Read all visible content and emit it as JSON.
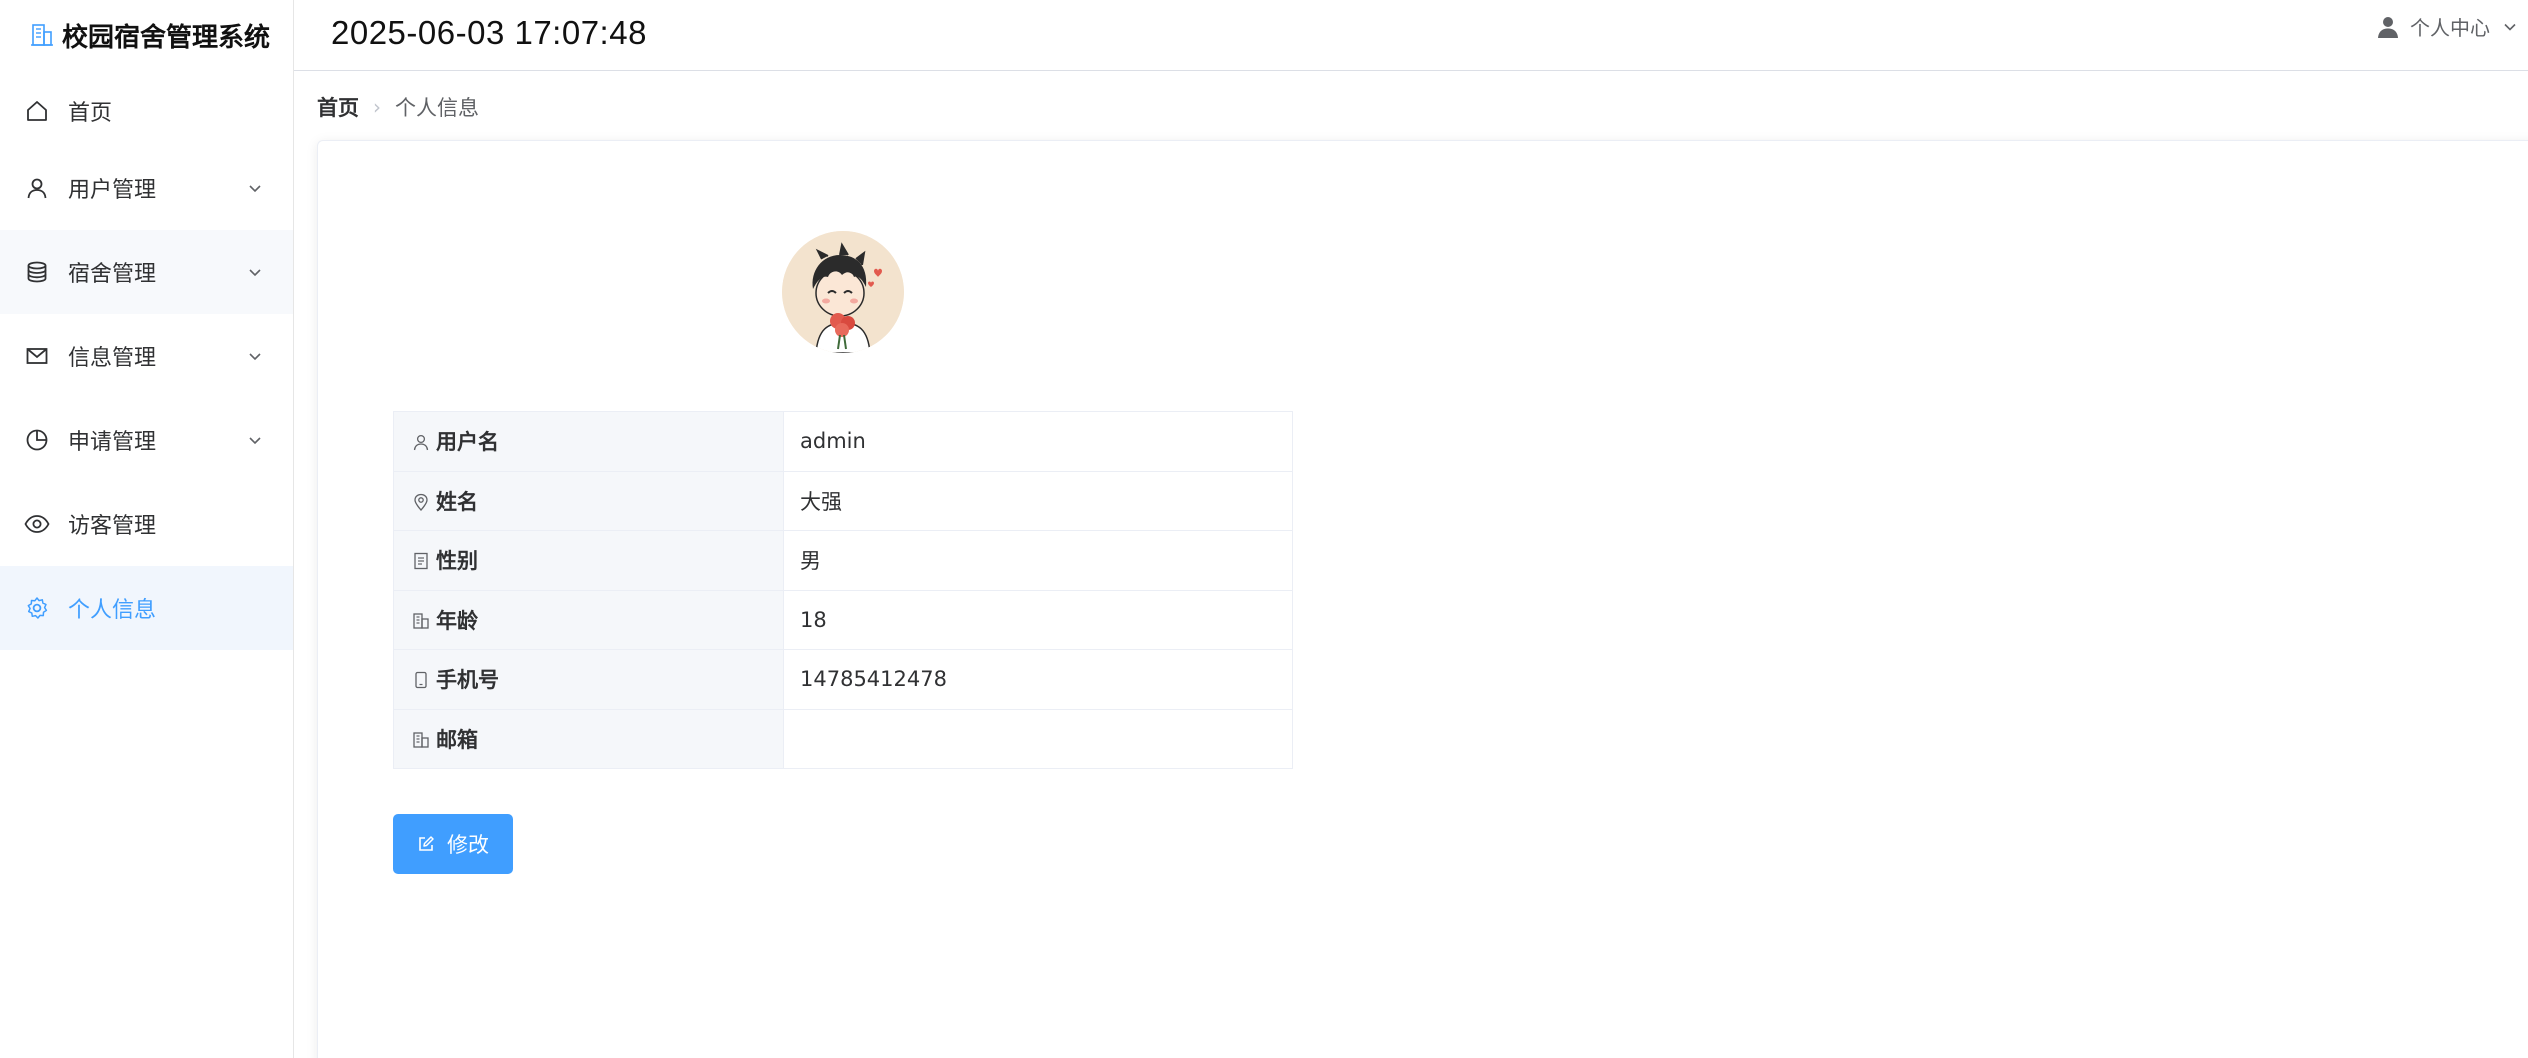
{
  "app": {
    "title": "校园宿舍管理系统",
    "accent_color": "#409eff"
  },
  "sidebar": {
    "items": [
      {
        "label": "首页",
        "icon": "home-icon",
        "has_children": false,
        "active": false
      },
      {
        "label": "用户管理",
        "icon": "user-icon",
        "has_children": true,
        "active": false
      },
      {
        "label": "宿舍管理",
        "icon": "database-icon",
        "has_children": true,
        "active": false
      },
      {
        "label": "信息管理",
        "icon": "mail-icon",
        "has_children": true,
        "active": false
      },
      {
        "label": "申请管理",
        "icon": "pie-chart-icon",
        "has_children": true,
        "active": false
      },
      {
        "label": "访客管理",
        "icon": "eye-icon",
        "has_children": false,
        "active": false
      },
      {
        "label": "个人信息",
        "icon": "gear-icon",
        "has_children": false,
        "active": true
      }
    ]
  },
  "header": {
    "datetime": "2025-06-03 17:07:48",
    "user_menu_label": "个人中心"
  },
  "breadcrumb": {
    "home": "首页",
    "current": "个人信息"
  },
  "profile": {
    "fields": [
      {
        "label": "用户名",
        "icon": "user-icon",
        "value": "admin"
      },
      {
        "label": "姓名",
        "icon": "location-icon",
        "value": "大强"
      },
      {
        "label": "性别",
        "icon": "document-icon",
        "value": "男"
      },
      {
        "label": "年龄",
        "icon": "building-icon",
        "value": "18"
      },
      {
        "label": "手机号",
        "icon": "phone-icon",
        "value": "14785412478"
      },
      {
        "label": "邮箱",
        "icon": "building-icon",
        "value": ""
      }
    ],
    "edit_button_label": "修改"
  }
}
